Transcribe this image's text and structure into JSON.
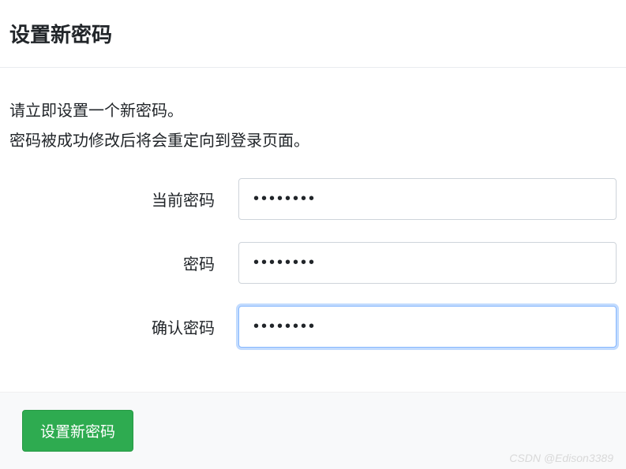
{
  "header": {
    "title": "设置新密码"
  },
  "description": {
    "line1": "请立即设置一个新密码。",
    "line2": "密码被成功修改后将会重定向到登录页面。"
  },
  "form": {
    "current_password": {
      "label": "当前密码",
      "value": "••••••••"
    },
    "password": {
      "label": "密码",
      "value": "••••••••"
    },
    "confirm_password": {
      "label": "确认密码",
      "value": "••••••••"
    }
  },
  "footer": {
    "submit_label": "设置新密码"
  },
  "watermark": "CSDN @Edison3389"
}
